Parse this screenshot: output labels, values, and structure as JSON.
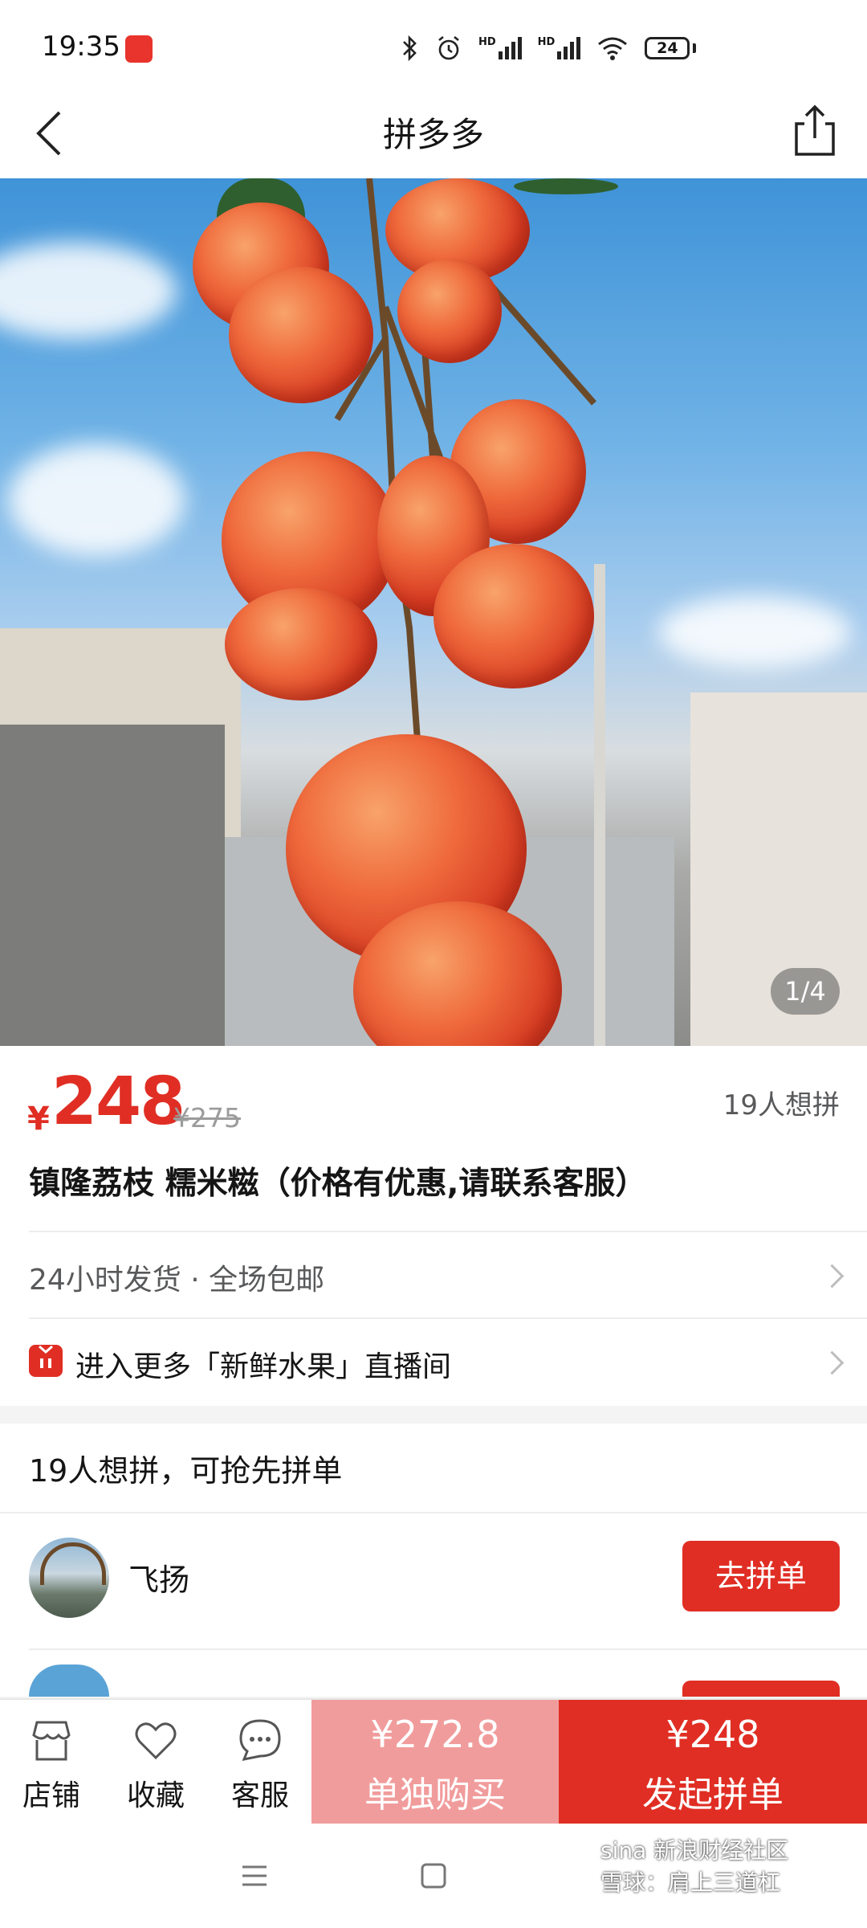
{
  "status_bar": {
    "time": "19:35",
    "battery": "24",
    "icons": [
      "bluetooth-icon",
      "alarm-icon",
      "signal-hd-icon",
      "signal-hd-icon",
      "wifi-icon",
      "battery-icon"
    ],
    "hd_label": "HD"
  },
  "nav": {
    "title": "拼多多"
  },
  "hero": {
    "counter": "1/4"
  },
  "product": {
    "currency": "¥",
    "price": "248",
    "original_price": "¥275",
    "want_count": "19人想拼",
    "title": "镇隆荔枝 糯米糍（价格有优惠,请联系客服）",
    "shipping": "24小时发货 · 全场包邮",
    "live": "进入更多「新鲜水果」直播间"
  },
  "group": {
    "heading": "19人想拼，可抢先拼单",
    "user_name": "飞扬",
    "join_label": "去拼单"
  },
  "bottom_bar": {
    "shop": "店铺",
    "favorite": "收藏",
    "service": "客服",
    "solo_price": "¥272.8",
    "solo_label": "单独购买",
    "group_price": "¥248",
    "group_label": "发起拼单"
  },
  "watermark": {
    "line1": "sina 新浪财经社区",
    "line2": "雪球：肩上三道杠"
  },
  "colors": {
    "accent": "#e02e24",
    "solo_button": "#f19c9c"
  }
}
